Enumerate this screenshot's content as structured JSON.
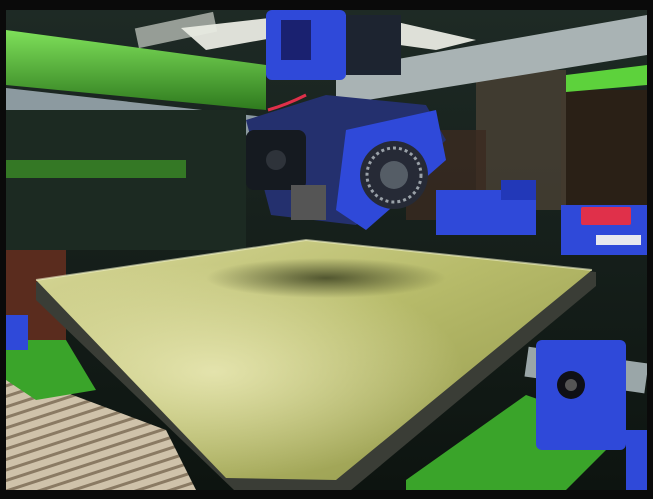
{
  "photo": {
    "subject": "3d-printer-heated-bed-and-hotend",
    "colors": {
      "frame_green": "#59c83a",
      "printed_parts_blue": "#2f49d9",
      "bed_surface": "#c7c77a",
      "accent_red": "#e0304a",
      "ceiling_light": "#f4f4ec"
    },
    "regions": [
      "ceiling-light",
      "green-aluminium-frame",
      "blue-printed-carriage",
      "cooling-fan",
      "build-plate",
      "left-rail",
      "right-rail-mount",
      "floor-carpet"
    ]
  }
}
